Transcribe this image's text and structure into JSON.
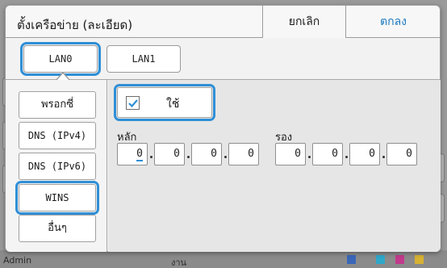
{
  "dialog": {
    "title": "ตั้งเครือข่าย (ละเอียด)",
    "cancel_label": "ยกเลิก",
    "ok_label": "ตกลง"
  },
  "lan_tabs": [
    {
      "label": "LAN0",
      "selected": true
    },
    {
      "label": "LAN1",
      "selected": false
    }
  ],
  "menu": [
    {
      "label": "พรอกซี่",
      "selected": false
    },
    {
      "label": "DNS (IPv4)",
      "selected": false
    },
    {
      "label": "DNS (IPv6)",
      "selected": false
    },
    {
      "label": "WINS",
      "selected": true
    },
    {
      "label": "อื่นๆ",
      "selected": false
    }
  ],
  "wins": {
    "use_label": "ใช้",
    "use_checked": true,
    "primary_label": "หลัก",
    "secondary_label": "รอง",
    "primary": [
      "0",
      "0",
      "0",
      "0"
    ],
    "secondary": [
      "0",
      "0",
      "0",
      "0"
    ]
  },
  "statusbar": {
    "user": "Admin",
    "job": "งาน"
  },
  "colors": {
    "accent": "#2f8fd6",
    "ok_text": "#1c79c0"
  }
}
